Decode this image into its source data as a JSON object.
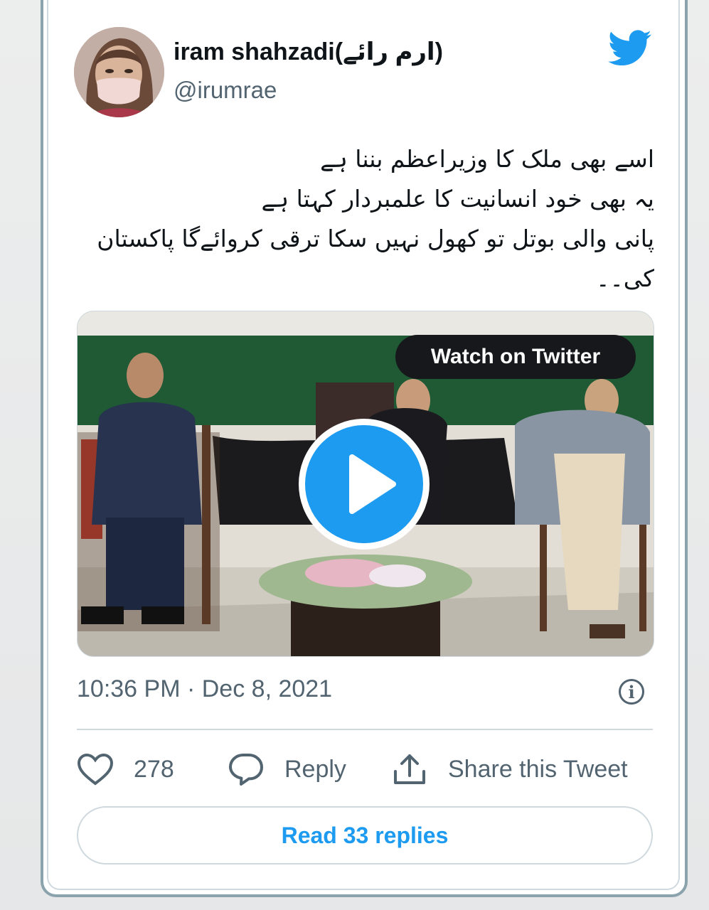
{
  "tweet": {
    "display_name": "iram shahzadi(ارم رائے)",
    "handle": "@irumrae",
    "text_lines": [
      "اسے بھی ملک کا وزیراعظم بننا ہے",
      "یہ بھی خود انسانیت کا علمبردار کہتا ہے",
      "پانی والی بوتل تو کھول نہیں سکا ترقی کروائےگا پاکستان",
      "کی۔۔"
    ],
    "timestamp": "10:36 PM · Dec 8, 2021"
  },
  "media": {
    "watch_label": "Watch on Twitter"
  },
  "actions": {
    "likes_count": "278",
    "reply_label": "Reply",
    "share_label": "Share this Tweet",
    "read_replies_label": "Read 33 replies"
  },
  "icons": {
    "brand": "twitter-bird-icon",
    "info": "info-icon",
    "like": "heart-icon",
    "reply": "speech-bubble-icon",
    "share": "share-upload-icon",
    "play": "play-icon"
  },
  "colors": {
    "twitter_blue": "#1d9bf0",
    "text_primary": "#0f1419",
    "text_secondary": "#536471",
    "border": "#cfd9de"
  }
}
